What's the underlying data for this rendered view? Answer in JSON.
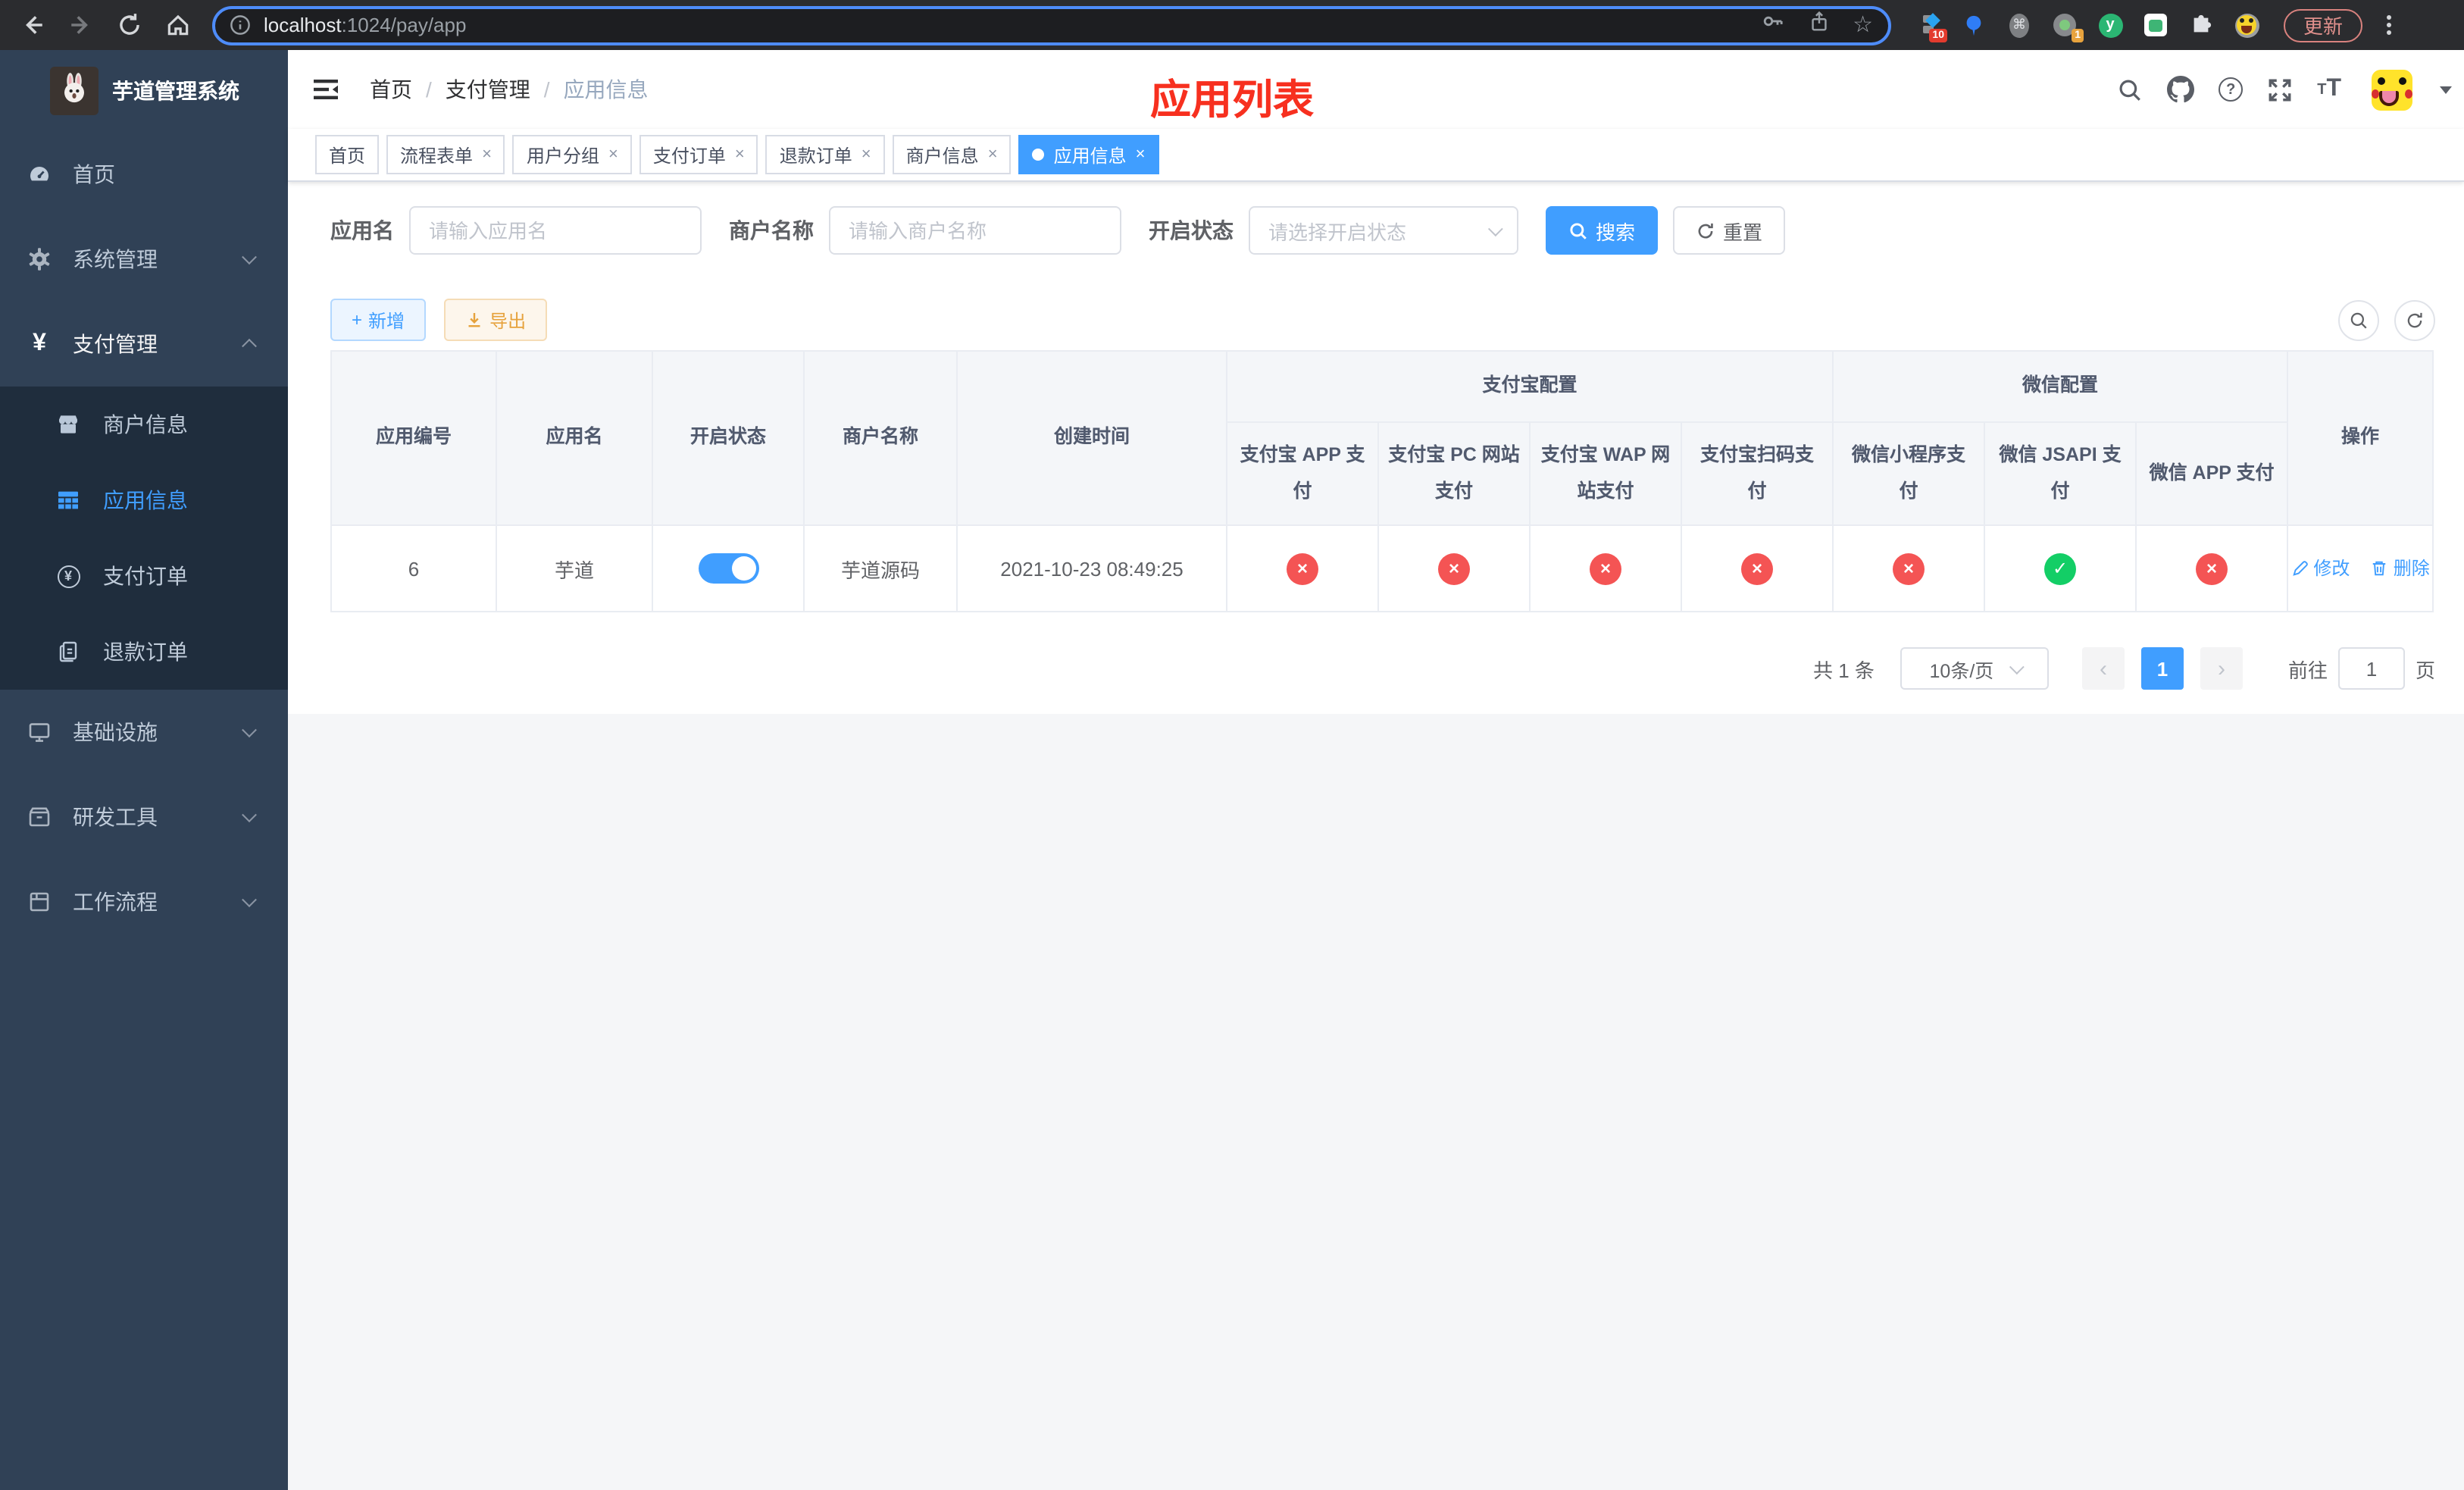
{
  "browser": {
    "url_host": "localhost",
    "url_rest": ":1024/pay/app",
    "update_label": "更新",
    "ext_badge_blue": "10",
    "ext_badge_orange": "1"
  },
  "sidebar": {
    "title": "芋道管理系统",
    "items": [
      {
        "label": "首页"
      },
      {
        "label": "系统管理"
      },
      {
        "label": "支付管理"
      },
      {
        "label": "商户信息"
      },
      {
        "label": "应用信息"
      },
      {
        "label": "支付订单"
      },
      {
        "label": "退款订单"
      },
      {
        "label": "基础设施"
      },
      {
        "label": "研发工具"
      },
      {
        "label": "工作流程"
      }
    ]
  },
  "header": {
    "breadcrumb": [
      "首页",
      "支付管理",
      "应用信息"
    ],
    "page_title": "应用列表"
  },
  "tabs": [
    {
      "label": "首页"
    },
    {
      "label": "流程表单"
    },
    {
      "label": "用户分组"
    },
    {
      "label": "支付订单"
    },
    {
      "label": "退款订单"
    },
    {
      "label": "商户信息"
    },
    {
      "label": "应用信息"
    }
  ],
  "filters": {
    "app_name_label": "应用名",
    "app_name_placeholder": "请输入应用名",
    "merchant_label": "商户名称",
    "merchant_placeholder": "请输入商户名称",
    "status_label": "开启状态",
    "status_placeholder": "请选择开启状态",
    "search_label": "搜索",
    "reset_label": "重置"
  },
  "toolbar": {
    "add_label": "新增",
    "export_label": "导出"
  },
  "table": {
    "group_alipay": "支付宝配置",
    "group_wechat": "微信配置",
    "columns": [
      "应用编号",
      "应用名",
      "开启状态",
      "商户名称",
      "创建时间",
      "支付宝 APP 支付",
      "支付宝 PC 网站支付",
      "支付宝 WAP 网站支付",
      "支付宝扫码支付",
      "微信小程序支付",
      "微信 JSAPI 支付",
      "微信 APP 支付",
      "操作"
    ],
    "actions": {
      "edit": "修改",
      "delete": "删除"
    },
    "rows": [
      {
        "id": "6",
        "name": "芋道",
        "enabled": true,
        "merchant": "芋道源码",
        "created": "2021-10-23 08:49:25",
        "statuses": [
          "no",
          "no",
          "no",
          "no",
          "no",
          "yes",
          "no"
        ]
      }
    ]
  },
  "pagination": {
    "total": "共 1 条",
    "page_size": "10条/页",
    "current_page": "1",
    "goto_label": "前往",
    "goto_value": "1",
    "page_unit": "页"
  },
  "colors": {
    "accent": "#409eff",
    "danger": "#f45454",
    "success": "#13ce66",
    "title_red": "#f7301f",
    "sidebar_bg": "#304156",
    "submenu_bg": "#1f2d3d"
  }
}
